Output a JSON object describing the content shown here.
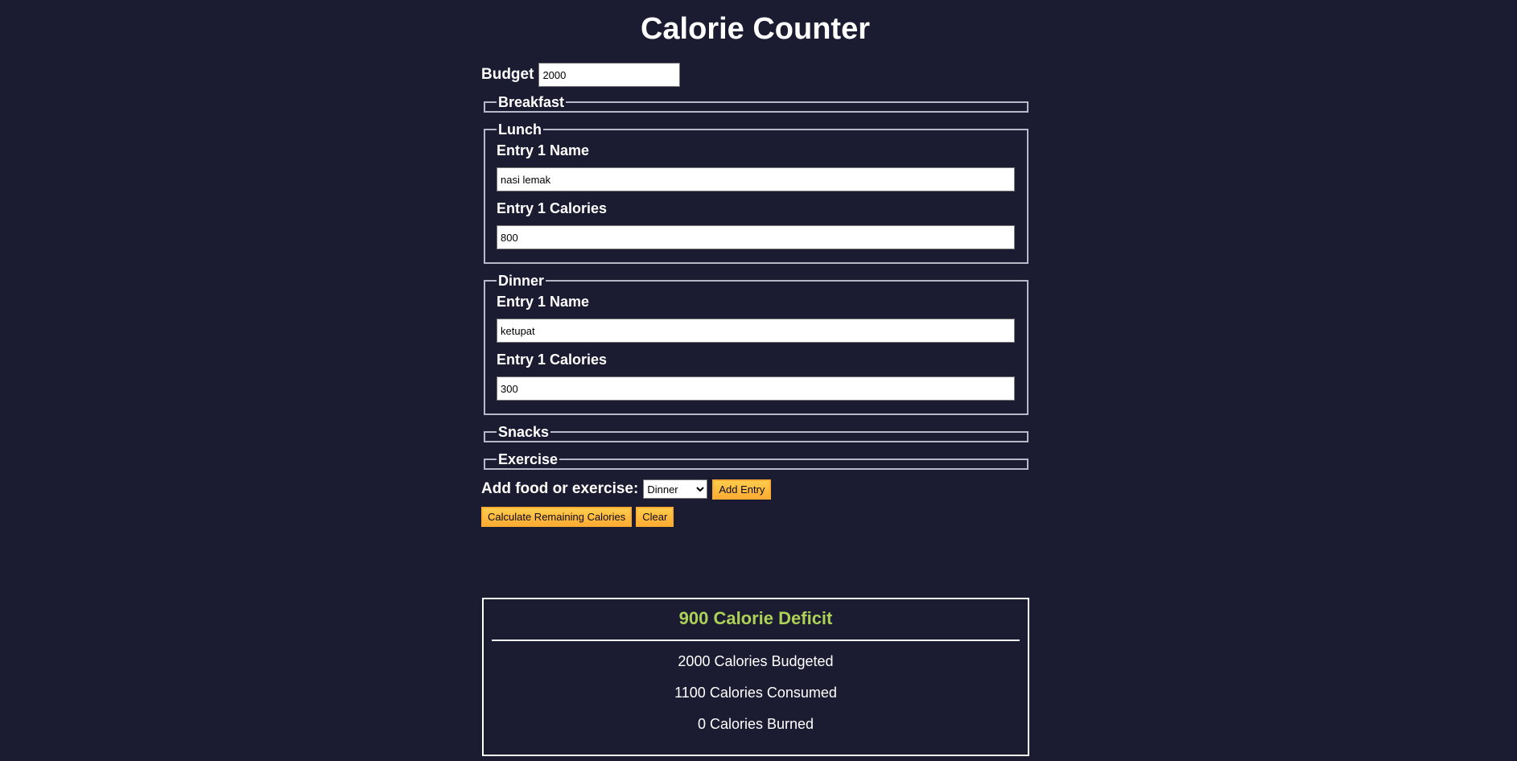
{
  "app": {
    "title": "Calorie Counter"
  },
  "budget": {
    "label": "Budget",
    "value": "2000"
  },
  "sections": {
    "breakfast": {
      "legend": "Breakfast"
    },
    "lunch": {
      "legend": "Lunch",
      "entry_name_label": "Entry 1 Name",
      "entry_name_value": "nasi lemak",
      "entry_calories_label": "Entry 1 Calories",
      "entry_calories_value": "800"
    },
    "dinner": {
      "legend": "Dinner",
      "entry_name_label": "Entry 1 Name",
      "entry_name_value": "ketupat",
      "entry_calories_label": "Entry 1 Calories",
      "entry_calories_value": "300"
    },
    "snacks": {
      "legend": "Snacks"
    },
    "exercise": {
      "legend": "Exercise"
    }
  },
  "add_entry": {
    "label": "Add food or exercise:",
    "selected_option": "Dinner",
    "button_label": "Add Entry"
  },
  "actions": {
    "calculate_label": "Calculate Remaining Calories",
    "clear_label": "Clear"
  },
  "output": {
    "result": "900 Calorie Deficit",
    "budgeted": "2000 Calories Budgeted",
    "consumed": "1100 Calories Consumed",
    "burned": "0 Calories Burned"
  },
  "colors": {
    "background": "#1b1b32",
    "button": "#feac32",
    "deficit": "#acd157"
  }
}
